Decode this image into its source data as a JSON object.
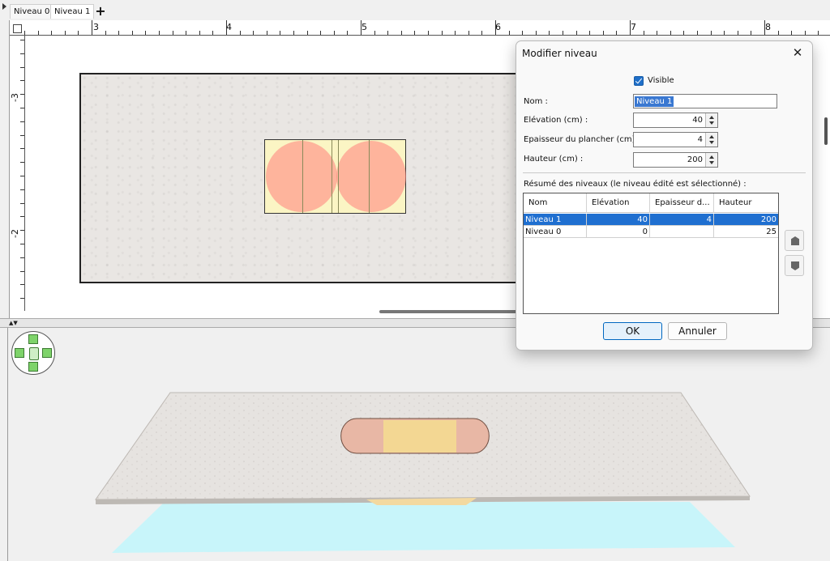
{
  "tabs": [
    {
      "label": "Niveau 0"
    },
    {
      "label": "Niveau 1"
    }
  ],
  "tab_add_label": "+",
  "ruler": {
    "horizontal": [
      "3",
      "4",
      "5",
      "6",
      "7",
      "8"
    ],
    "vertical": [
      "-3",
      "-2"
    ]
  },
  "icons": {
    "tab_add": "plus-icon",
    "close": "close-icon",
    "checkbox": "checkmark-icon",
    "level_up": "level-up-icon",
    "level_down": "level-down-icon",
    "navigation": "navigation-arrows-icon"
  },
  "colors": {
    "accent": "#1f6fd0",
    "floor": "#e9e6e3",
    "well_circles": "#ff8c82",
    "well_fill": "#fbf5c4",
    "ground_3d": "#c9f6fb",
    "nav_green": "#7ed36a"
  },
  "dialog": {
    "title": "Modifier niveau",
    "close_label": "✕",
    "visible_label": "Visible",
    "visible_checked": true,
    "name_label": "Nom :",
    "name_value": "Niveau 1",
    "elevation_label": "Elévation (cm) :",
    "elevation_value": "40",
    "floor_thickness_label": "Epaisseur du plancher (cm) :",
    "floor_thickness_value": "4",
    "height_label": "Hauteur (cm) :",
    "height_value": "200",
    "summary_label": "Résumé des niveaux (le niveau édité est sélectionné) :",
    "table": {
      "headers": [
        "Nom",
        "Elévation",
        "Epaisseur d...",
        "Hauteur"
      ],
      "rows": [
        {
          "name": "Niveau 1",
          "elevation": "40",
          "thickness": "4",
          "height": "200",
          "selected": true
        },
        {
          "name": "Niveau 0",
          "elevation": "0",
          "thickness": "",
          "height": "25",
          "selected": false
        }
      ]
    },
    "ok_label": "OK",
    "cancel_label": "Annuler"
  }
}
